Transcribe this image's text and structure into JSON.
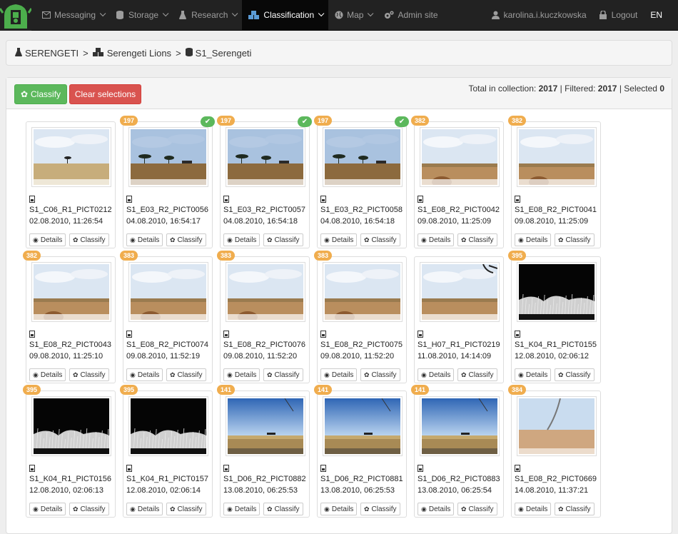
{
  "navbar": {
    "items": [
      {
        "label": "Messaging",
        "icon": "envelope-icon",
        "caret": true
      },
      {
        "label": "Storage",
        "icon": "database-icon",
        "caret": true
      },
      {
        "label": "Research",
        "icon": "flask-icon",
        "caret": true
      },
      {
        "label": "Classification",
        "icon": "cubes-icon",
        "caret": true,
        "active": true
      },
      {
        "label": "Map",
        "icon": "globe-icon",
        "caret": true
      },
      {
        "label": "Admin site",
        "icon": "cogs-icon",
        "caret": false
      }
    ],
    "user": "karolina.i.kuczkowska",
    "logout": "Logout",
    "lang": "EN"
  },
  "breadcrumb": {
    "items": [
      "SERENGETI",
      "Serengeti Lions",
      "S1_Serengeti"
    ],
    "sep": ">"
  },
  "toolbar": {
    "classify_label": "Classify",
    "clear_label": "Clear selections",
    "totals": {
      "collection_label": "Total in collection:",
      "collection": "2017",
      "filtered_label": "Filtered:",
      "filtered": "2017",
      "selected_label": "Selected",
      "selected": "0"
    }
  },
  "card_buttons": {
    "details": "Details",
    "classify": "Classify"
  },
  "cards": [
    {
      "name": "S1_C06_R1_PICT0212",
      "date": "02.08.2010, 11:26:54",
      "badge": "",
      "checked": false,
      "scene": "day-tree"
    },
    {
      "name": "S1_E03_R2_PICT0056",
      "date": "04.08.2010, 16:54:17",
      "badge": "197",
      "checked": true,
      "scene": "day-trees"
    },
    {
      "name": "S1_E03_R2_PICT0057",
      "date": "04.08.2010, 16:54:18",
      "badge": "197",
      "checked": true,
      "scene": "day-trees"
    },
    {
      "name": "S1_E03_R2_PICT0058",
      "date": "04.08.2010, 16:54:18",
      "badge": "197",
      "checked": true,
      "scene": "day-trees"
    },
    {
      "name": "S1_E08_R2_PICT0042",
      "date": "09.08.2010, 11:25:09",
      "badge": "382",
      "checked": false,
      "scene": "plain"
    },
    {
      "name": "S1_E08_R2_PICT0041",
      "date": "09.08.2010, 11:25:09",
      "badge": "382",
      "checked": false,
      "scene": "plain"
    },
    {
      "name": "S1_E08_R2_PICT0043",
      "date": "09.08.2010, 11:25:10",
      "badge": "382",
      "checked": false,
      "scene": "plain"
    },
    {
      "name": "S1_E08_R2_PICT0074",
      "date": "09.08.2010, 11:52:19",
      "badge": "383",
      "checked": false,
      "scene": "plain"
    },
    {
      "name": "S1_E08_R2_PICT0076",
      "date": "09.08.2010, 11:52:20",
      "badge": "383",
      "checked": false,
      "scene": "plain"
    },
    {
      "name": "S1_E08_R2_PICT0075",
      "date": "09.08.2010, 11:52:20",
      "badge": "383",
      "checked": false,
      "scene": "plain"
    },
    {
      "name": "S1_H07_R1_PICT0219",
      "date": "11.08.2010, 14:14:09",
      "badge": "",
      "checked": false,
      "scene": "plain-branch"
    },
    {
      "name": "S1_K04_R1_PICT0155",
      "date": "12.08.2010, 02:06:12",
      "badge": "395",
      "checked": false,
      "scene": "night"
    },
    {
      "name": "S1_K04_R1_PICT0156",
      "date": "12.08.2010, 02:06:13",
      "badge": "395",
      "checked": false,
      "scene": "night"
    },
    {
      "name": "S1_K04_R1_PICT0157",
      "date": "12.08.2010, 02:06:14",
      "badge": "395",
      "checked": false,
      "scene": "night"
    },
    {
      "name": "S1_D06_R2_PICT0882",
      "date": "13.08.2010, 06:25:53",
      "badge": "141",
      "checked": false,
      "scene": "dawn"
    },
    {
      "name": "S1_D06_R2_PICT0881",
      "date": "13.08.2010, 06:25:53",
      "badge": "141",
      "checked": false,
      "scene": "dawn"
    },
    {
      "name": "S1_D06_R2_PICT0883",
      "date": "13.08.2010, 06:25:54",
      "badge": "141",
      "checked": false,
      "scene": "dawn"
    },
    {
      "name": "S1_E08_R2_PICT0669",
      "date": "14.08.2010, 11:37:21",
      "badge": "384",
      "checked": false,
      "scene": "grass"
    }
  ],
  "colors": {
    "navbar": "#222222",
    "badge": "#f0ad4e",
    "success": "#5cb85c",
    "danger": "#d9534f"
  }
}
